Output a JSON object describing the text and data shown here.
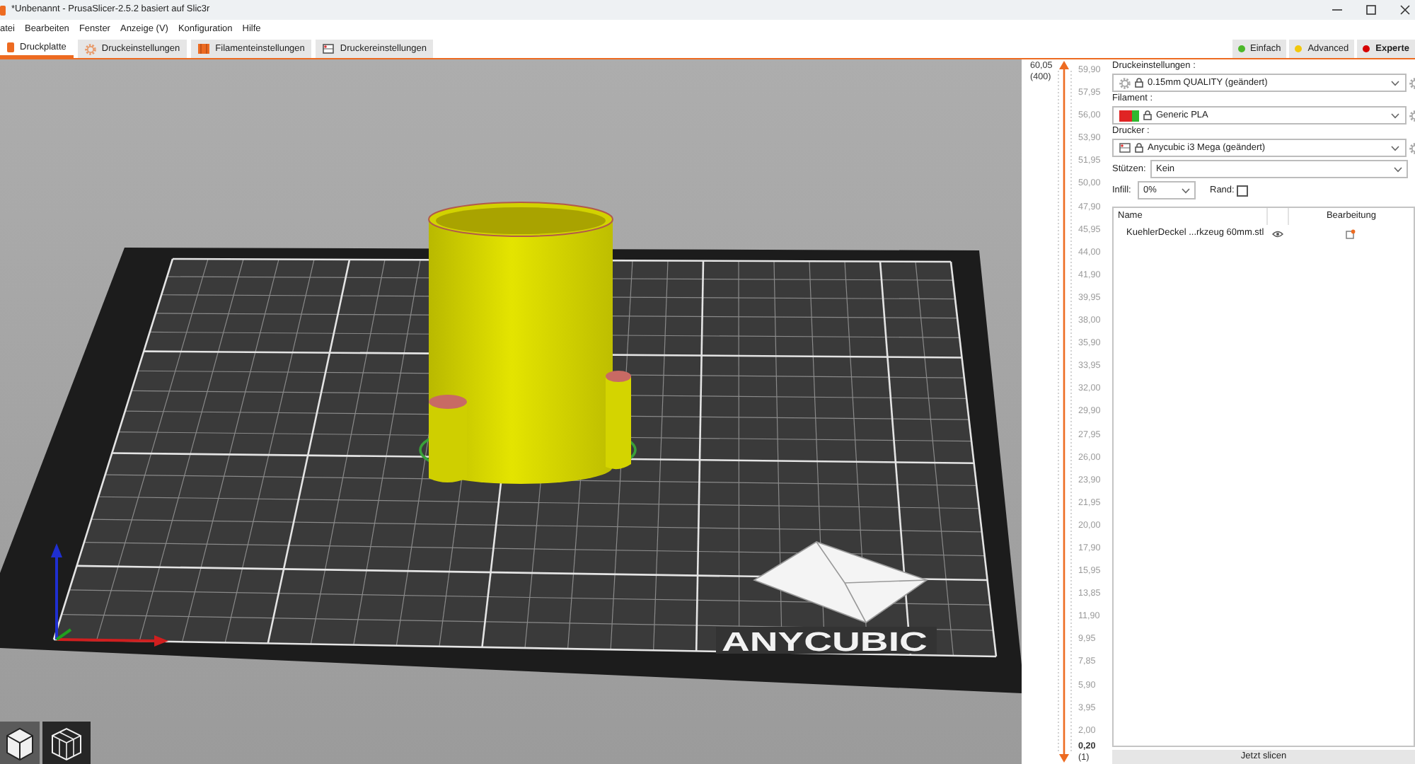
{
  "window": {
    "title": "*Unbenannt - PrusaSlicer-2.5.2 basiert auf Slic3r"
  },
  "menu": [
    "atei",
    "Bearbeiten",
    "Fenster",
    "Anzeige (V)",
    "Konfiguration",
    "Hilfe"
  ],
  "tabs": [
    {
      "label": "Druckplatte",
      "kind": "plater",
      "selected": true
    },
    {
      "label": "Druckeinstellungen",
      "kind": "print",
      "selected": false
    },
    {
      "label": "Filamenteinstellungen",
      "kind": "filament",
      "selected": false
    },
    {
      "label": "Druckereinstellungen",
      "kind": "printer",
      "selected": false
    }
  ],
  "modes": [
    {
      "label": "Einfach",
      "color": "#4cb82a",
      "selected": false
    },
    {
      "label": "Advanced",
      "color": "#f2c80c",
      "selected": false
    },
    {
      "label": "Experte",
      "color": "#d60000",
      "selected": true
    }
  ],
  "scene": {
    "bed_logo": "ANYCUBIC"
  },
  "layer_slider": {
    "top_value": "60,05",
    "top_layer": "(400)",
    "ticks": [
      "59,90",
      "57,95",
      "56,00",
      "53,90",
      "51,95",
      "50,00",
      "47,90",
      "45,95",
      "44,00",
      "41,90",
      "39,95",
      "38,00",
      "35,90",
      "33,95",
      "32,00",
      "29,90",
      "27,95",
      "26,00",
      "23,90",
      "21,95",
      "20,00",
      "17,90",
      "15,95",
      "13,85",
      "11,90",
      "9,95",
      "7,85",
      "5,90",
      "3,95",
      "2,00"
    ],
    "bottom_value": "0,20",
    "bottom_layer": "(1)"
  },
  "sidebar": {
    "presets": [
      {
        "label": "Druckeinstellungen :",
        "kind": "print",
        "value": "0.15mm QUALITY (geändert)"
      },
      {
        "label": "Filament :",
        "kind": "filament",
        "value": "Generic PLA"
      },
      {
        "label": "Drucker :",
        "kind": "printer",
        "value": "Anycubic i3 Mega (geändert)"
      }
    ],
    "supports": {
      "label": "Stützen:",
      "value": "Kein"
    },
    "infill": {
      "label": "Infill:",
      "value": "0%"
    },
    "brim": {
      "label": "Rand:",
      "checked": false
    },
    "object_list": {
      "columns": [
        "Name",
        "Bearbeitung"
      ],
      "rows": [
        {
          "name": "KuehlerDeckel ...rkzeug 60mm.stl"
        }
      ]
    },
    "slice_button": "Jetzt slicen"
  }
}
